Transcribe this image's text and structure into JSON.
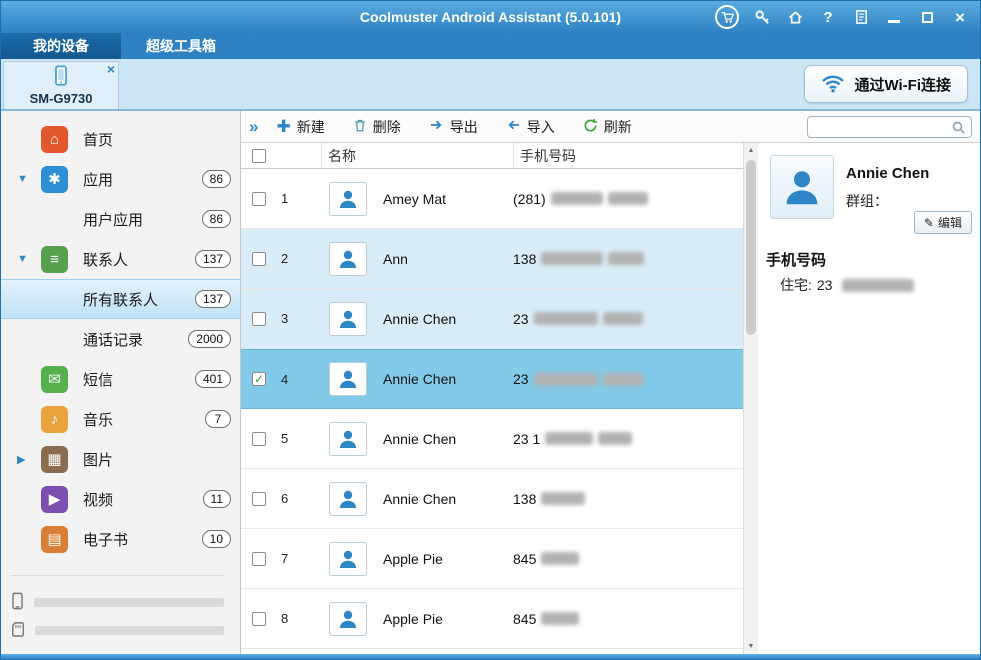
{
  "window": {
    "title": "Coolmuster Android Assistant (5.0.101)",
    "help": "?",
    "close": "×"
  },
  "tabs": [
    {
      "label": "我的设备"
    },
    {
      "label": "超级工具箱"
    }
  ],
  "device": {
    "name": "SM-G9730",
    "close": "×",
    "wifi_button_label": "通过Wi-Fi连接"
  },
  "sidebar": {
    "items": [
      {
        "id": "home",
        "label": "首页",
        "icon": {
          "glyph": "⌂",
          "color": "#e2572b"
        }
      },
      {
        "id": "apps",
        "label": "应用",
        "count": "86",
        "expand": "down",
        "icon": {
          "glyph": "✱",
          "color": "#2f8fd5"
        }
      },
      {
        "id": "user-apps",
        "label": "用户应用",
        "count": "86",
        "child": true
      },
      {
        "id": "contacts",
        "label": "联系人",
        "count": "137",
        "expand": "down",
        "icon": {
          "glyph": "≡",
          "color": "#57a14e"
        }
      },
      {
        "id": "all-contacts",
        "label": "所有联系人",
        "count": "137",
        "child": true,
        "selected": true
      },
      {
        "id": "call-logs",
        "label": "通话记录",
        "count": "2000",
        "child": true
      },
      {
        "id": "sms",
        "label": "短信",
        "count": "401",
        "icon": {
          "glyph": "✉",
          "color": "#56b04c"
        }
      },
      {
        "id": "music",
        "label": "音乐",
        "count": "7",
        "icon": {
          "glyph": "♪",
          "color": "#e8a33d"
        }
      },
      {
        "id": "photos",
        "label": "图片",
        "expand": "right",
        "icon": {
          "glyph": "▦",
          "color": "#8a6d4f"
        }
      },
      {
        "id": "videos",
        "label": "视频",
        "count": "11",
        "icon": {
          "glyph": "▶",
          "color": "#7b4fb0"
        }
      },
      {
        "id": "ebooks",
        "label": "电子书",
        "count": "10",
        "icon": {
          "glyph": "▤",
          "color": "#d97e35"
        }
      }
    ]
  },
  "toolbar": {
    "collapse": "»",
    "buttons": [
      {
        "id": "new",
        "label": "新建"
      },
      {
        "id": "delete",
        "label": "删除"
      },
      {
        "id": "export",
        "label": "导出"
      },
      {
        "id": "import",
        "label": "导入"
      },
      {
        "id": "refresh",
        "label": "刷新"
      }
    ]
  },
  "table": {
    "columns": {
      "name": "名称",
      "phone": "手机号码"
    },
    "rows": [
      {
        "num": "1",
        "name": "Amey Mat",
        "phone_visible": "(281) ",
        "blur": [
          52,
          40
        ]
      },
      {
        "num": "2",
        "name": "Ann",
        "phone_visible": "138",
        "blur": [
          62,
          36
        ],
        "tint": true
      },
      {
        "num": "3",
        "name": "Annie Chen",
        "phone_visible": "23 ",
        "blur": [
          64,
          40
        ],
        "tint": true
      },
      {
        "num": "4",
        "name": "Annie Chen",
        "phone_visible": "23 ",
        "blur": [
          64,
          40
        ],
        "selected": true,
        "checked": true
      },
      {
        "num": "5",
        "name": "Annie Chen",
        "phone_visible": "23 1",
        "blur": [
          48,
          34
        ]
      },
      {
        "num": "6",
        "name": "Annie Chen",
        "phone_visible": "138 ",
        "blur": [
          44,
          0
        ]
      },
      {
        "num": "7",
        "name": "Apple Pie",
        "phone_visible": "845",
        "blur": [
          38,
          0
        ]
      },
      {
        "num": "8",
        "name": "Apple Pie",
        "phone_visible": "845",
        "blur": [
          38,
          0
        ]
      }
    ]
  },
  "detail": {
    "name": "Annie Chen",
    "group_label": "群组：",
    "edit_icon": "✎",
    "edit_label": "编辑",
    "phone_section": "手机号码",
    "home_label": "住宅:",
    "home_value": "23"
  }
}
